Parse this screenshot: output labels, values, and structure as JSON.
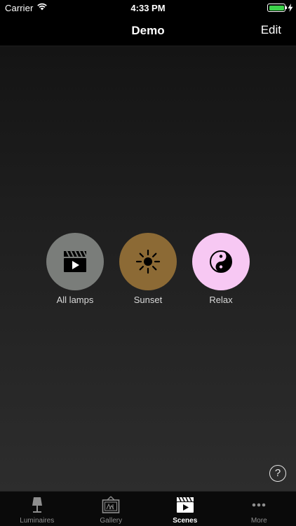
{
  "status_bar": {
    "carrier": "Carrier",
    "time": "4:33 PM",
    "battery_color": "#3dd44b"
  },
  "nav": {
    "title": "Demo",
    "edit_label": "Edit"
  },
  "scenes": [
    {
      "label": "All lamps",
      "icon": "clapperboard-icon",
      "color": "#7a7d7a"
    },
    {
      "label": "Sunset",
      "icon": "sun-icon",
      "color": "#8c6a35"
    },
    {
      "label": "Relax",
      "icon": "yin-yang-icon",
      "color": "#f7c8f3"
    }
  ],
  "help": {
    "label": "?"
  },
  "tab_bar": {
    "tabs": [
      {
        "label": "Luminaires",
        "icon": "lamp-icon",
        "active": false
      },
      {
        "label": "Gallery",
        "icon": "picture-frame-icon",
        "active": false
      },
      {
        "label": "Scenes",
        "icon": "clapperboard-icon",
        "active": true
      },
      {
        "label": "More",
        "icon": "more-dots-icon",
        "active": false
      }
    ]
  }
}
